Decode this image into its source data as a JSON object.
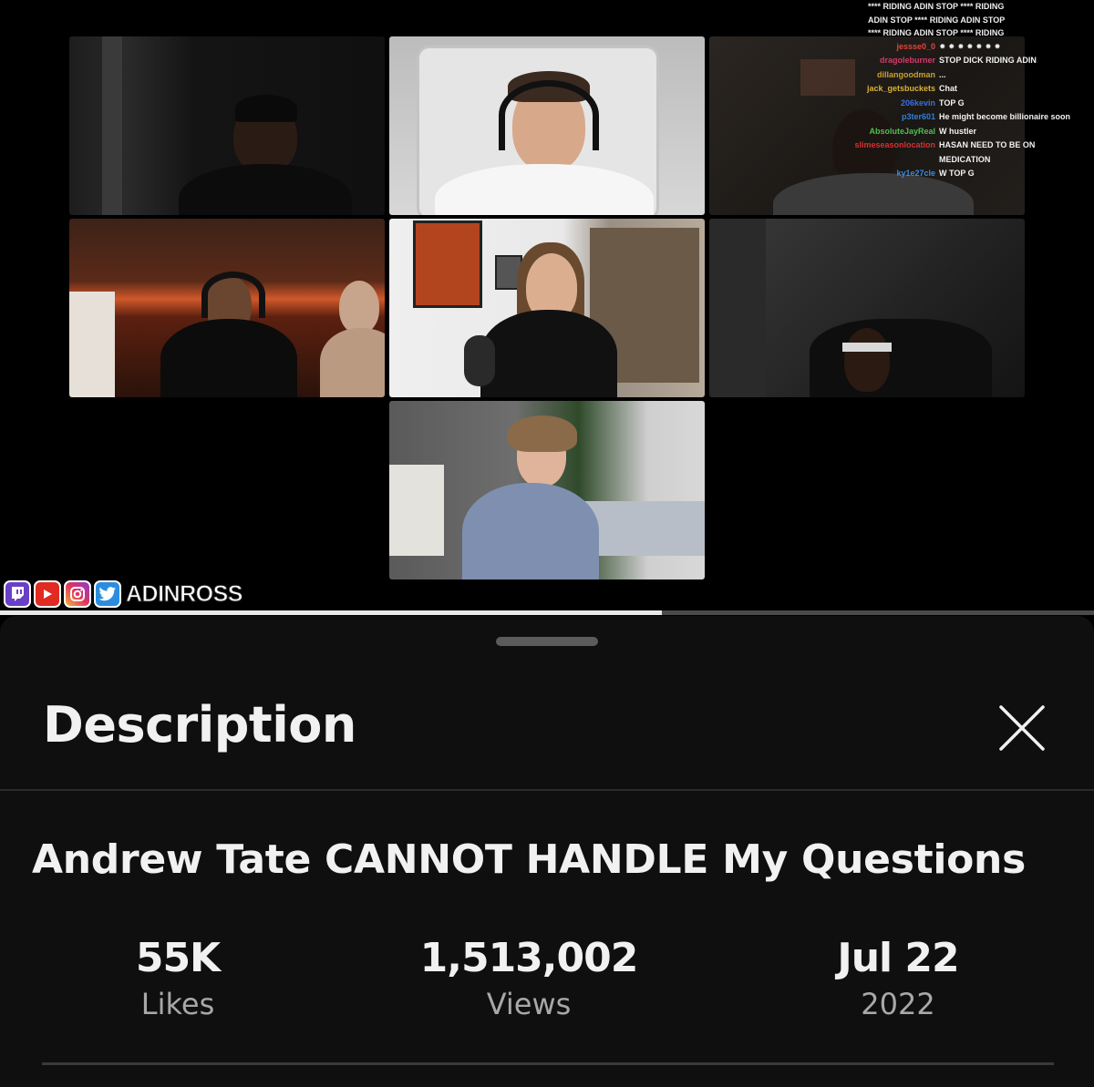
{
  "video": {
    "chat": {
      "spam_lines": [
        "**** RIDING ADIN STOP **** RIDING",
        "ADIN STOP **** RIDING ADIN STOP",
        "**** RIDING ADIN STOP **** RIDING"
      ],
      "messages": [
        {
          "user": "jessse0_0",
          "color": "#e0463b",
          "text": "⁕ ⁕ ⁕ ⁕ ⁕ ⁕ ⁕"
        },
        {
          "user": "dragoleburner",
          "color": "#d43a6c",
          "text": "STOP DICK RIDING ADIN"
        },
        {
          "user": "dillangoodman",
          "color": "#c9a12e",
          "text": "..."
        },
        {
          "user": "jack_getsbuckets",
          "color": "#d8b23a",
          "text": "Chat"
        },
        {
          "user": "206kevin",
          "color": "#3a6ee0",
          "text": "TOP G"
        },
        {
          "user": "p3ter601",
          "color": "#2f7fd8",
          "text": "He might become billionaire soon"
        },
        {
          "user": "AbsoluteJayReal",
          "color": "#4fbf4f",
          "text": "W hustler"
        },
        {
          "user": "slimeseasonlocation",
          "color": "#d93030",
          "text": "HASAN NEED TO BE ON MEDICATION"
        },
        {
          "user": "ky1e27cle",
          "color": "#3a8be0",
          "text": "W TOP G"
        }
      ]
    },
    "social": {
      "icons": [
        "twitch-icon",
        "youtube-icon",
        "instagram-icon",
        "twitter-icon"
      ],
      "handle": "ADINROSS"
    },
    "progress_fraction": 0.605
  },
  "sheet": {
    "title": "Description",
    "video_title": "Andrew Tate CANNOT HANDLE My Questions",
    "stats": {
      "likes_value": "55K",
      "likes_label": "Likes",
      "views_value": "1,513,002",
      "views_label": "Views",
      "date_value": "Jul 22",
      "date_year": "2022"
    }
  },
  "colors": {
    "sheet_bg": "#0f0f0f",
    "muted_text": "#a8a8a8"
  }
}
